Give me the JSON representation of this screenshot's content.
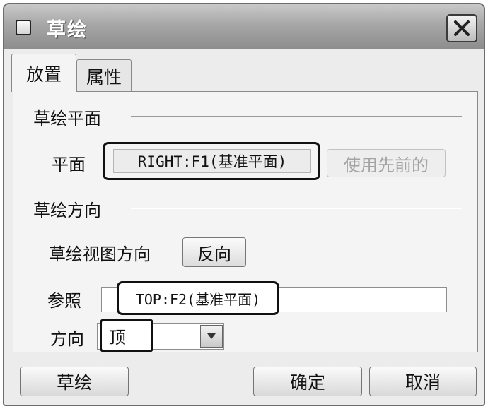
{
  "window": {
    "title": "草绘",
    "icon": "window-icon",
    "close_icon": "close-icon"
  },
  "tabs": [
    {
      "label": "放置",
      "active": true
    },
    {
      "label": "属性",
      "active": false
    }
  ],
  "sketch_plane": {
    "group_label": "草绘平面",
    "plane_label": "平面",
    "plane_value": "RIGHT:F1(基准平面)",
    "use_previous_button": "使用先前的"
  },
  "sketch_orientation": {
    "group_label": "草绘方向",
    "view_direction_label": "草绘视图方向",
    "flip_button": "反向",
    "reference_label": "参照",
    "reference_value": "TOP:F2(基准平面)",
    "direction_label": "方向",
    "direction_value": "顶"
  },
  "footer": {
    "sketch_button": "草绘",
    "ok_button": "确定",
    "cancel_button": "取消"
  },
  "colors": {
    "title_text": "#ffffff",
    "highlight_border": "#111111",
    "disabled_text": "#a3a3a3"
  }
}
